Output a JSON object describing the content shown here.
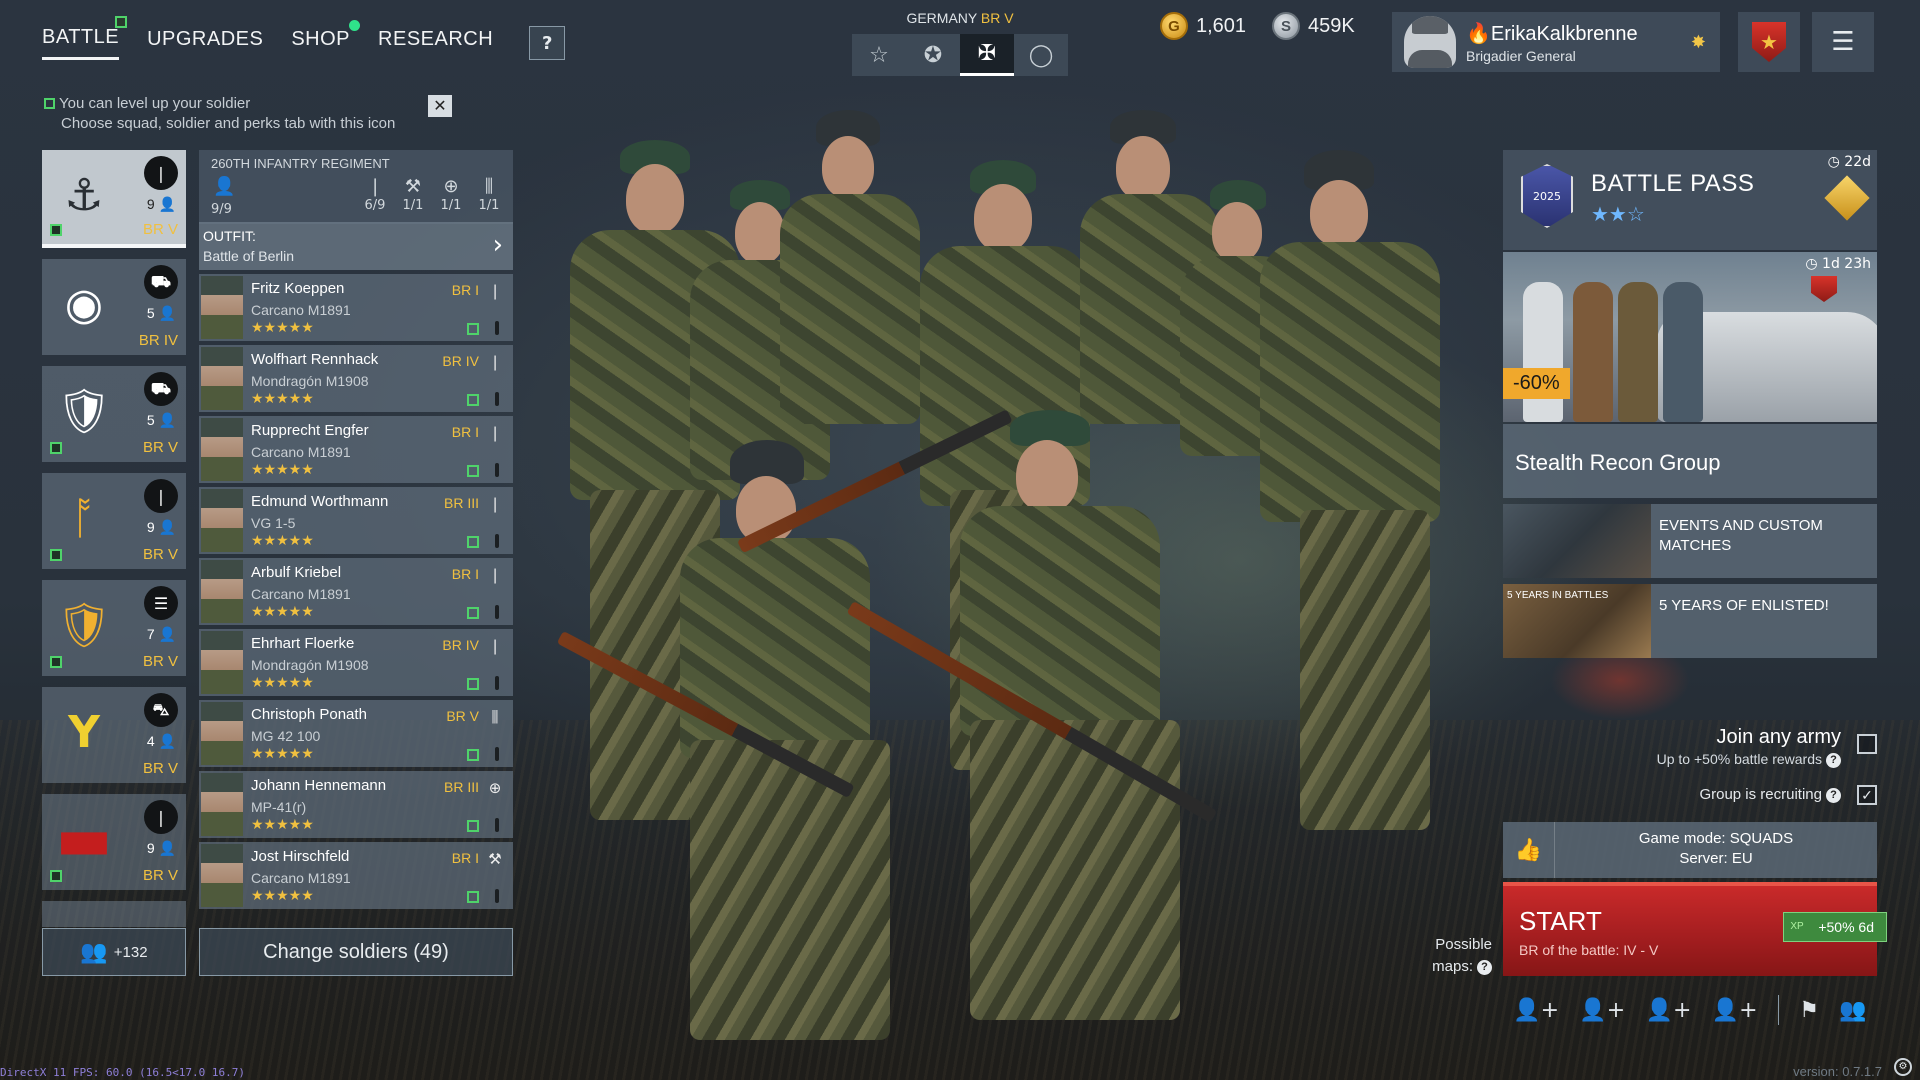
{
  "nav": {
    "tabs": [
      {
        "label": "BATTLE"
      },
      {
        "label": "UPGRADES"
      },
      {
        "label": "SHOP"
      },
      {
        "label": "RESEARCH"
      }
    ],
    "help": "?"
  },
  "hint": {
    "line1": "You can level up your soldier",
    "line2": "Choose squad, soldier and perks tab with this icon",
    "close": "✕"
  },
  "country": {
    "label": "GERMANY",
    "br": "BR V",
    "options": [
      "☆",
      "✪",
      "✠",
      "◯"
    ]
  },
  "currency": {
    "gold": "1,601",
    "gold_icon": "G",
    "silver": "459K",
    "silver_icon": "S"
  },
  "profile": {
    "name": "🔥ErikaKalkbrenne",
    "rank": "Brigadier General",
    "rank_icon": "✸"
  },
  "squads": [
    {
      "icon": "⚓",
      "cls": "❘",
      "count": "9",
      "br": "BR V"
    },
    {
      "icon": "◉",
      "cls": "⛟",
      "count": "5",
      "br": "BR IV"
    },
    {
      "icon": "🛡",
      "cls": "⛟",
      "count": "5",
      "br": "BR V"
    },
    {
      "icon": "ᚩ",
      "cls": "❘",
      "count": "9",
      "br": "BR V"
    },
    {
      "icon": "🛡",
      "cls": "☰",
      "count": "7",
      "br": "BR V"
    },
    {
      "icon": "Y",
      "cls": "⛍",
      "count": "4",
      "br": "BR V"
    },
    {
      "icon": "▬",
      "cls": "❘",
      "count": "9",
      "br": "BR V"
    }
  ],
  "squads_button": {
    "label": "+132",
    "icon": "👥"
  },
  "regiment": {
    "title": "260TH INFANTRY REGIMENT",
    "capacity": "9/9",
    "slots": [
      {
        "icon": "❘",
        "value": "6/9"
      },
      {
        "icon": "⚒",
        "value": "1/1"
      },
      {
        "icon": "⊕",
        "value": "1/1"
      },
      {
        "icon": "⫼",
        "value": "1/1"
      }
    ]
  },
  "outfit": {
    "label": "OUTFIT:",
    "value": "Battle of Berlin",
    "arrow": "›"
  },
  "soldiers": [
    {
      "name": "Fritz Koeppen",
      "weapon": "Carcano M1891",
      "br": "BR I",
      "role": "❘",
      "stars": "★★★★★"
    },
    {
      "name": "Wolfhart Rennhack",
      "weapon": "Mondragón M1908",
      "br": "BR IV",
      "role": "❘",
      "stars": "★★★★★"
    },
    {
      "name": "Rupprecht Engfer",
      "weapon": "Carcano M1891",
      "br": "BR I",
      "role": "❘",
      "stars": "★★★★★"
    },
    {
      "name": "Edmund Worthmann",
      "weapon": "VG 1-5",
      "br": "BR III",
      "role": "❘",
      "stars": "★★★★★"
    },
    {
      "name": "Arbulf Kriebel",
      "weapon": "Carcano M1891",
      "br": "BR I",
      "role": "❘",
      "stars": "★★★★★"
    },
    {
      "name": "Ehrhart Floerke",
      "weapon": "Mondragón M1908",
      "br": "BR IV",
      "role": "❘",
      "stars": "★★★★★"
    },
    {
      "name": "Christoph Ponath",
      "weapon": "MG 42 100",
      "br": "BR V",
      "role": "⫼",
      "stars": "★★★★★"
    },
    {
      "name": "Johann Hennemann",
      "weapon": "MP-41(r)",
      "br": "BR III",
      "role": "⊕",
      "stars": "★★★★★"
    },
    {
      "name": "Jost Hirschfeld",
      "weapon": "Carcano M1891",
      "br": "BR I",
      "role": "⚒",
      "stars": "★★★★★"
    }
  ],
  "change_soldiers": "Change soldiers (49)",
  "battle_pass": {
    "title": "BATTLE PASS",
    "logo_text": "2025",
    "stars": "★★☆",
    "timer": "◷ 22d"
  },
  "offer": {
    "discount": "-60%",
    "timer": "◷ 1d 23h",
    "title": "Stealth Recon Group"
  },
  "events": [
    {
      "label": "EVENTS AND CUSTOM MATCHES"
    },
    {
      "label": "5 YEARS OF ENLISTED!"
    }
  ],
  "event_thumb_text": "5 YEARS IN BATTLES",
  "join_army": {
    "title": "Join any army",
    "sub": "Up to +50% battle rewards",
    "checked": false
  },
  "recruiting": {
    "label": "Group is recruiting",
    "checked": true,
    "check": "✓"
  },
  "game_mode": {
    "mode": "Game mode: SQUADS",
    "server": "Server: EU",
    "like_icon": "👍"
  },
  "start": {
    "label": "START",
    "sub": "BR of the battle: IV - V",
    "xp_badge": "+50% 6d"
  },
  "maps": {
    "label1": "Possible",
    "label2": "maps:"
  },
  "invite_icons": [
    "👤+",
    "👤+",
    "👤+",
    "👤+",
    "⚑",
    "👥"
  ],
  "footer": {
    "fps": "DirectX 11 FPS: 60.0 (16.5<17.0 16.7)",
    "version": "version: 0.7.1.7",
    "settings_icon": "⚙"
  },
  "colors": {
    "accent_gold": "#f0c040",
    "start_red": "#c92a2a",
    "level_green": "#4fd36a"
  }
}
